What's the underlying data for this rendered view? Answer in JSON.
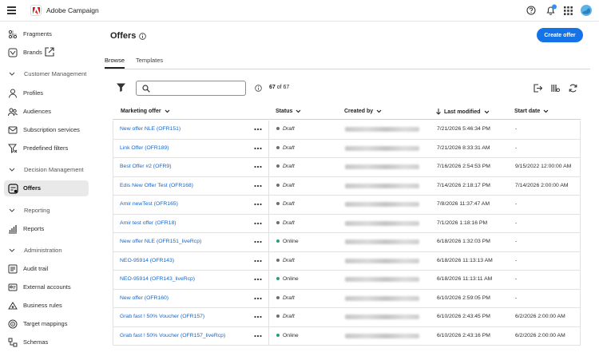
{
  "app": {
    "title": "Adobe Campaign",
    "logo_icon": "adobe-logo-icon"
  },
  "topbar_icons": [
    "help-icon",
    "notifications-icon",
    "apps-grid-icon",
    "user-avatar"
  ],
  "sidebar": {
    "items": [
      {
        "label": "Fragments",
        "icon": "fragments-icon"
      },
      {
        "label": "Brands",
        "icon": "brands-icon"
      },
      {
        "section": "Customer Management"
      },
      {
        "label": "Profiles",
        "icon": "person-icon"
      },
      {
        "label": "Audiences",
        "icon": "audiences-icon"
      },
      {
        "label": "Subscription services",
        "icon": "subscription-icon"
      },
      {
        "label": "Predefined filters",
        "icon": "filter-icon"
      },
      {
        "section": "Decision Management"
      },
      {
        "label": "Offers",
        "icon": "offers-icon",
        "active": true
      },
      {
        "section": "Reporting"
      },
      {
        "label": "Reports",
        "icon": "reports-icon"
      },
      {
        "section": "Administration"
      },
      {
        "label": "Audit trail",
        "icon": "audit-icon"
      },
      {
        "label": "External accounts",
        "icon": "external-accounts-icon"
      },
      {
        "label": "Business rules",
        "icon": "business-rules-icon"
      },
      {
        "label": "Target mappings",
        "icon": "target-mappings-icon"
      },
      {
        "label": "Schemas",
        "icon": "schemas-icon"
      }
    ]
  },
  "page": {
    "title": "Offers",
    "create_button": "Create offer",
    "tabs": [
      "Browse",
      "Templates"
    ],
    "search_placeholder": "",
    "count_shown": "67",
    "count_total": "of 67"
  },
  "table": {
    "columns": [
      "Marketing offer",
      "Status",
      "Created by",
      "Last modified",
      "Start date"
    ],
    "rows": [
      {
        "name": "New offer NLE (OFR151)",
        "status": "Draft",
        "modified": "7/21/2026 5:46:34 PM",
        "start": "-"
      },
      {
        "name": "Link Offer (OFR189)",
        "status": "Draft",
        "modified": "7/21/2026 8:33:31 AM",
        "start": "-"
      },
      {
        "name": "Best Offer #2 (OFR9)",
        "status": "Draft",
        "modified": "7/16/2026 2:54:53 PM",
        "start": "9/15/2022 12:00:00 AM"
      },
      {
        "name": "Edis New Offer Test (OFR168)",
        "status": "Draft",
        "modified": "7/14/2026 2:18:17 PM",
        "start": "7/14/2026 2:00:00 AM"
      },
      {
        "name": "Amir newTest (OFR165)",
        "status": "Draft",
        "modified": "7/8/2026 11:37:47 AM",
        "start": "-"
      },
      {
        "name": "Amir test offer (OFR18)",
        "status": "Draft",
        "modified": "7/1/2026 1:18:16 PM",
        "start": "-"
      },
      {
        "name": "New offer NLE (OFR151_liveRcp)",
        "status": "Online",
        "modified": "6/18/2026 1:32:03 PM",
        "start": "-"
      },
      {
        "name": "NEO-95914 (OFR143)",
        "status": "Draft",
        "modified": "6/18/2026 11:13:13 AM",
        "start": "-"
      },
      {
        "name": "NEO-95914 (OFR143_liveRcp)",
        "status": "Online",
        "modified": "6/18/2026 11:13:11 AM",
        "start": "-"
      },
      {
        "name": "New offer (OFR160)",
        "status": "Draft",
        "modified": "6/10/2026 2:59:05 PM",
        "start": "-"
      },
      {
        "name": "Grab fast ! 50% Voucher (OFR157)",
        "status": "Draft",
        "modified": "6/10/2026 2:43:45 PM",
        "start": "6/2/2026 2:00:00 AM"
      },
      {
        "name": "Grab fast ! 50% Voucher (OFR157_liveRcp)",
        "status": "Online",
        "modified": "6/10/2026 2:43:16 PM",
        "start": "6/2/2026 2:00:00 AM"
      }
    ]
  },
  "colors": {
    "accent": "#1473e6",
    "link": "#1765c9",
    "online": "#2d9d78",
    "draft": "#6e6e6e"
  }
}
